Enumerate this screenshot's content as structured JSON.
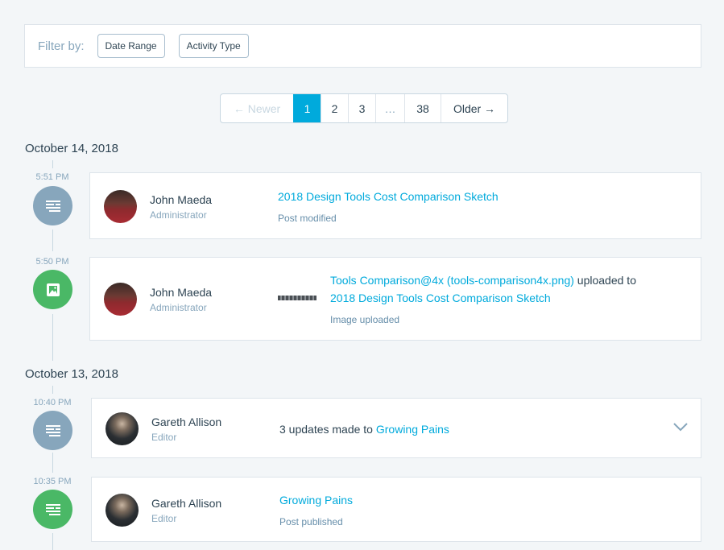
{
  "filter": {
    "label": "Filter by:",
    "buttons": [
      "Date Range",
      "Activity Type"
    ]
  },
  "pagination": {
    "newer": "← Newer",
    "pages": [
      "1",
      "2",
      "3"
    ],
    "ellipsis": "…",
    "last": "38",
    "older": "Older →",
    "current": "1"
  },
  "groups": [
    {
      "date": "October 14, 2018",
      "events": [
        {
          "time": "5:51 PM",
          "icon": "post-icon",
          "icon_color": "#87a6bc",
          "user": "John Maeda",
          "role": "Administrator",
          "title": "2018 Design Tools Cost Comparison Sketch",
          "subtitle": "Post modified"
        },
        {
          "time": "5:50 PM",
          "icon": "image-icon",
          "icon_color": "#4ab866",
          "user": "John Maeda",
          "role": "Administrator",
          "file_link": "Tools Comparison@4x (tools-comparison4x.png)",
          "connector": " uploaded to",
          "target_link": "2018 Design Tools Cost Comparison Sketch",
          "subtitle": "Image uploaded"
        }
      ]
    },
    {
      "date": "October 13, 2018",
      "events": [
        {
          "time": "10:40 PM",
          "icon": "post-icon",
          "icon_color": "#87a6bc",
          "user": "Gareth Allison",
          "role": "Editor",
          "summary_prefix": "3 updates made to ",
          "summary_link": "Growing Pains"
        },
        {
          "time": "10:35 PM",
          "icon": "post-icon",
          "icon_color": "#4ab866",
          "user": "Gareth Allison",
          "role": "Editor",
          "title": "Growing Pains",
          "subtitle": "Post published"
        }
      ]
    }
  ]
}
